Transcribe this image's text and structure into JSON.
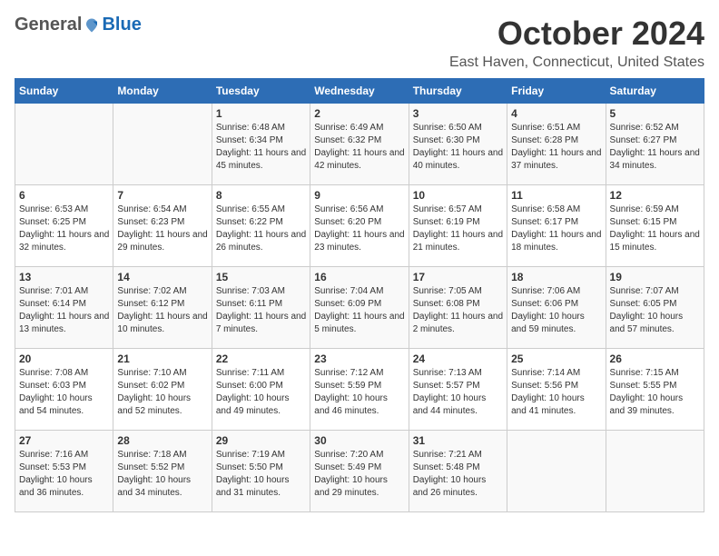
{
  "header": {
    "logo_general": "General",
    "logo_blue": "Blue",
    "month": "October 2024",
    "location": "East Haven, Connecticut, United States"
  },
  "days_of_week": [
    "Sunday",
    "Monday",
    "Tuesday",
    "Wednesday",
    "Thursday",
    "Friday",
    "Saturday"
  ],
  "weeks": [
    [
      {
        "day": "",
        "info": ""
      },
      {
        "day": "",
        "info": ""
      },
      {
        "day": "1",
        "info": "Sunrise: 6:48 AM\nSunset: 6:34 PM\nDaylight: 11 hours and 45 minutes."
      },
      {
        "day": "2",
        "info": "Sunrise: 6:49 AM\nSunset: 6:32 PM\nDaylight: 11 hours and 42 minutes."
      },
      {
        "day": "3",
        "info": "Sunrise: 6:50 AM\nSunset: 6:30 PM\nDaylight: 11 hours and 40 minutes."
      },
      {
        "day": "4",
        "info": "Sunrise: 6:51 AM\nSunset: 6:28 PM\nDaylight: 11 hours and 37 minutes."
      },
      {
        "day": "5",
        "info": "Sunrise: 6:52 AM\nSunset: 6:27 PM\nDaylight: 11 hours and 34 minutes."
      }
    ],
    [
      {
        "day": "6",
        "info": "Sunrise: 6:53 AM\nSunset: 6:25 PM\nDaylight: 11 hours and 32 minutes."
      },
      {
        "day": "7",
        "info": "Sunrise: 6:54 AM\nSunset: 6:23 PM\nDaylight: 11 hours and 29 minutes."
      },
      {
        "day": "8",
        "info": "Sunrise: 6:55 AM\nSunset: 6:22 PM\nDaylight: 11 hours and 26 minutes."
      },
      {
        "day": "9",
        "info": "Sunrise: 6:56 AM\nSunset: 6:20 PM\nDaylight: 11 hours and 23 minutes."
      },
      {
        "day": "10",
        "info": "Sunrise: 6:57 AM\nSunset: 6:19 PM\nDaylight: 11 hours and 21 minutes."
      },
      {
        "day": "11",
        "info": "Sunrise: 6:58 AM\nSunset: 6:17 PM\nDaylight: 11 hours and 18 minutes."
      },
      {
        "day": "12",
        "info": "Sunrise: 6:59 AM\nSunset: 6:15 PM\nDaylight: 11 hours and 15 minutes."
      }
    ],
    [
      {
        "day": "13",
        "info": "Sunrise: 7:01 AM\nSunset: 6:14 PM\nDaylight: 11 hours and 13 minutes."
      },
      {
        "day": "14",
        "info": "Sunrise: 7:02 AM\nSunset: 6:12 PM\nDaylight: 11 hours and 10 minutes."
      },
      {
        "day": "15",
        "info": "Sunrise: 7:03 AM\nSunset: 6:11 PM\nDaylight: 11 hours and 7 minutes."
      },
      {
        "day": "16",
        "info": "Sunrise: 7:04 AM\nSunset: 6:09 PM\nDaylight: 11 hours and 5 minutes."
      },
      {
        "day": "17",
        "info": "Sunrise: 7:05 AM\nSunset: 6:08 PM\nDaylight: 11 hours and 2 minutes."
      },
      {
        "day": "18",
        "info": "Sunrise: 7:06 AM\nSunset: 6:06 PM\nDaylight: 10 hours and 59 minutes."
      },
      {
        "day": "19",
        "info": "Sunrise: 7:07 AM\nSunset: 6:05 PM\nDaylight: 10 hours and 57 minutes."
      }
    ],
    [
      {
        "day": "20",
        "info": "Sunrise: 7:08 AM\nSunset: 6:03 PM\nDaylight: 10 hours and 54 minutes."
      },
      {
        "day": "21",
        "info": "Sunrise: 7:10 AM\nSunset: 6:02 PM\nDaylight: 10 hours and 52 minutes."
      },
      {
        "day": "22",
        "info": "Sunrise: 7:11 AM\nSunset: 6:00 PM\nDaylight: 10 hours and 49 minutes."
      },
      {
        "day": "23",
        "info": "Sunrise: 7:12 AM\nSunset: 5:59 PM\nDaylight: 10 hours and 46 minutes."
      },
      {
        "day": "24",
        "info": "Sunrise: 7:13 AM\nSunset: 5:57 PM\nDaylight: 10 hours and 44 minutes."
      },
      {
        "day": "25",
        "info": "Sunrise: 7:14 AM\nSunset: 5:56 PM\nDaylight: 10 hours and 41 minutes."
      },
      {
        "day": "26",
        "info": "Sunrise: 7:15 AM\nSunset: 5:55 PM\nDaylight: 10 hours and 39 minutes."
      }
    ],
    [
      {
        "day": "27",
        "info": "Sunrise: 7:16 AM\nSunset: 5:53 PM\nDaylight: 10 hours and 36 minutes."
      },
      {
        "day": "28",
        "info": "Sunrise: 7:18 AM\nSunset: 5:52 PM\nDaylight: 10 hours and 34 minutes."
      },
      {
        "day": "29",
        "info": "Sunrise: 7:19 AM\nSunset: 5:50 PM\nDaylight: 10 hours and 31 minutes."
      },
      {
        "day": "30",
        "info": "Sunrise: 7:20 AM\nSunset: 5:49 PM\nDaylight: 10 hours and 29 minutes."
      },
      {
        "day": "31",
        "info": "Sunrise: 7:21 AM\nSunset: 5:48 PM\nDaylight: 10 hours and 26 minutes."
      },
      {
        "day": "",
        "info": ""
      },
      {
        "day": "",
        "info": ""
      }
    ]
  ]
}
